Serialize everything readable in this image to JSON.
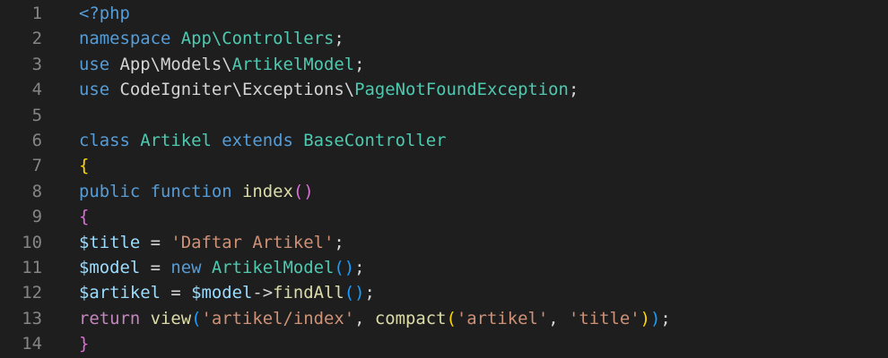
{
  "editor": {
    "colors": {
      "default": "#d4d4d4",
      "keyword": "#569cd6",
      "control": "#c586c0",
      "type": "#4ec9b0",
      "variable": "#9cdcfe",
      "string": "#ce9178",
      "function": "#dcdcaa",
      "bracket1": "#ffd700",
      "bracket2": "#da70d6",
      "bracket3": "#179fff",
      "line_number": "#858585",
      "background": "#1e1e1e"
    },
    "lines": [
      {
        "number": "1",
        "tokens": [
          [
            "<?php",
            "keyword"
          ]
        ]
      },
      {
        "number": "2",
        "tokens": [
          [
            "namespace",
            "keyword"
          ],
          [
            " ",
            "default"
          ],
          [
            "App\\Controllers",
            "type"
          ],
          [
            ";",
            "default"
          ]
        ]
      },
      {
        "number": "3",
        "tokens": [
          [
            "use",
            "keyword"
          ],
          [
            " App\\Models\\",
            "default"
          ],
          [
            "ArtikelModel",
            "type"
          ],
          [
            ";",
            "default"
          ]
        ]
      },
      {
        "number": "4",
        "tokens": [
          [
            "use",
            "keyword"
          ],
          [
            " CodeIgniter\\Exceptions\\",
            "default"
          ],
          [
            "PageNotFoundException",
            "type"
          ],
          [
            ";",
            "default"
          ]
        ]
      },
      {
        "number": "5",
        "tokens": []
      },
      {
        "number": "6",
        "tokens": [
          [
            "class",
            "keyword"
          ],
          [
            " ",
            "default"
          ],
          [
            "Artikel",
            "type"
          ],
          [
            " ",
            "default"
          ],
          [
            "extends",
            "keyword"
          ],
          [
            " ",
            "default"
          ],
          [
            "BaseController",
            "type"
          ]
        ]
      },
      {
        "number": "7",
        "tokens": [
          [
            "{",
            "bracket1"
          ]
        ]
      },
      {
        "number": "8",
        "tokens": [
          [
            "public",
            "keyword"
          ],
          [
            " ",
            "default"
          ],
          [
            "function",
            "keyword"
          ],
          [
            " ",
            "default"
          ],
          [
            "index",
            "function"
          ],
          [
            "()",
            "bracket2"
          ]
        ]
      },
      {
        "number": "9",
        "tokens": [
          [
            "{",
            "bracket2"
          ]
        ]
      },
      {
        "number": "10",
        "tokens": [
          [
            "$title",
            "variable"
          ],
          [
            " = ",
            "default"
          ],
          [
            "'Daftar Artikel'",
            "string"
          ],
          [
            ";",
            "default"
          ]
        ]
      },
      {
        "number": "11",
        "tokens": [
          [
            "$model",
            "variable"
          ],
          [
            " = ",
            "default"
          ],
          [
            "new",
            "keyword"
          ],
          [
            " ",
            "default"
          ],
          [
            "ArtikelModel",
            "type"
          ],
          [
            "()",
            "bracket3"
          ],
          [
            ";",
            "default"
          ]
        ]
      },
      {
        "number": "12",
        "tokens": [
          [
            "$artikel",
            "variable"
          ],
          [
            " = ",
            "default"
          ],
          [
            "$model",
            "variable"
          ],
          [
            "->",
            "default"
          ],
          [
            "findAll",
            "function"
          ],
          [
            "()",
            "bracket3"
          ],
          [
            ";",
            "default"
          ]
        ]
      },
      {
        "number": "13",
        "tokens": [
          [
            "return",
            "control"
          ],
          [
            " ",
            "default"
          ],
          [
            "view",
            "function"
          ],
          [
            "(",
            "bracket3"
          ],
          [
            "'artikel/index'",
            "string"
          ],
          [
            ", ",
            "default"
          ],
          [
            "compact",
            "function"
          ],
          [
            "(",
            "bracket1"
          ],
          [
            "'artikel'",
            "string"
          ],
          [
            ", ",
            "default"
          ],
          [
            "'title'",
            "string"
          ],
          [
            ")",
            "bracket1"
          ],
          [
            ")",
            "bracket3"
          ],
          [
            ";",
            "default"
          ]
        ]
      },
      {
        "number": "14",
        "tokens": [
          [
            "}",
            "bracket2"
          ]
        ]
      }
    ]
  }
}
